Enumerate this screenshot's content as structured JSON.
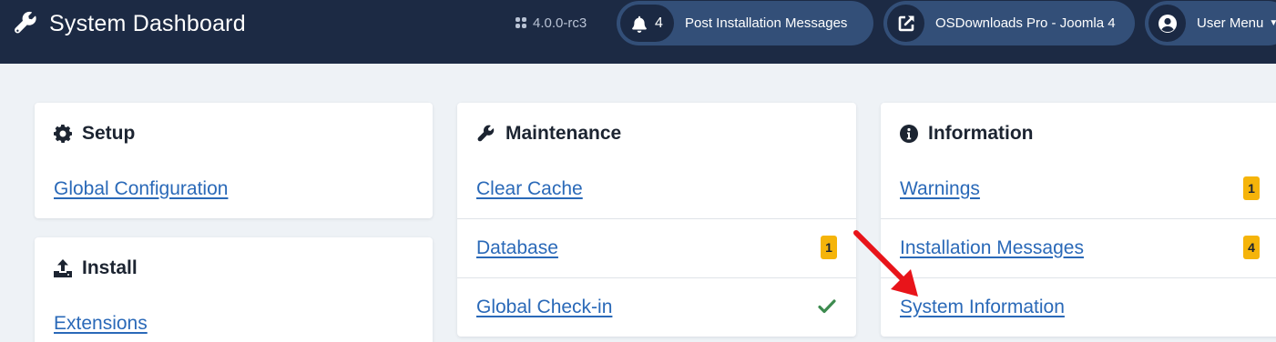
{
  "header": {
    "title": "System Dashboard",
    "version": "4.0.0-rc3",
    "post_install_count": "4",
    "post_install_label": "Post Installation Messages",
    "site_link_label": "OSDownloads Pro - Joomla 4",
    "user_menu_label": "User Menu"
  },
  "setup": {
    "title": "Setup",
    "items": [
      {
        "label": "Global Configuration"
      }
    ]
  },
  "install": {
    "title": "Install",
    "items": [
      {
        "label": "Extensions"
      }
    ]
  },
  "maintenance": {
    "title": "Maintenance",
    "items": [
      {
        "label": "Clear Cache"
      },
      {
        "label": "Database",
        "badge": "1"
      },
      {
        "label": "Global Check-in"
      }
    ]
  },
  "information": {
    "title": "Information",
    "items": [
      {
        "label": "Warnings",
        "badge": "1"
      },
      {
        "label": "Installation Messages",
        "badge": "4"
      },
      {
        "label": "System Information"
      }
    ]
  },
  "colors": {
    "header_bg": "#1c2a44",
    "pill_bg": "#334f78",
    "link": "#2a69b8",
    "badge": "#f5b40a",
    "check": "#3d8b4f",
    "annotation_arrow": "#e8141a"
  }
}
